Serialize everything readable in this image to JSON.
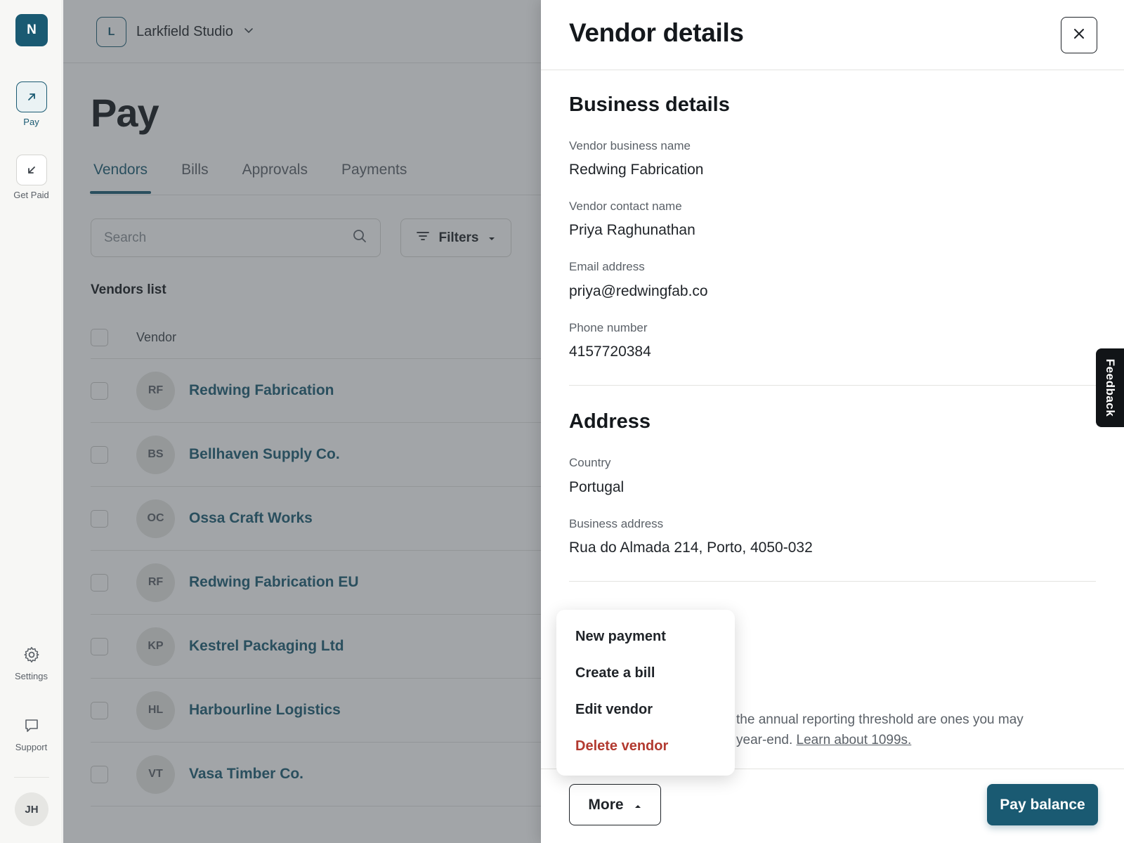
{
  "rail": {
    "org_initial": "N",
    "items": [
      {
        "label": "Pay",
        "icon": "arrow-up-right-icon",
        "active": true
      },
      {
        "label": "Get Paid",
        "icon": "arrow-down-left-icon",
        "active": false
      },
      {
        "label": "Settings",
        "icon": "gear-icon",
        "active": false
      },
      {
        "label": "Support",
        "icon": "chat-bubble-icon",
        "active": false
      }
    ],
    "user_initials": "JH"
  },
  "topbar": {
    "org_initial": "L",
    "org_name": "Larkfield Studio",
    "icon": "chevron-down-icon"
  },
  "page": {
    "title": "Pay",
    "tabs": [
      {
        "label": "Vendors",
        "active": true
      },
      {
        "label": "Bills",
        "active": false
      },
      {
        "label": "Approvals",
        "active": false
      },
      {
        "label": "Payments",
        "active": false
      }
    ],
    "search": {
      "placeholder": "Search",
      "value": ""
    },
    "filters_label": "Filters",
    "list_title": "Vendors list",
    "table": {
      "columns": [
        "Vendor"
      ],
      "rows": [
        {
          "initials": "RF",
          "name": "Redwing Fabrication"
        },
        {
          "initials": "BS",
          "name": "Bellhaven Supply Co."
        },
        {
          "initials": "OC",
          "name": "Ossa Craft Works"
        },
        {
          "initials": "RF",
          "name": "Redwing Fabrication EU"
        },
        {
          "initials": "KP",
          "name": "Kestrel Packaging Ltd"
        },
        {
          "initials": "HL",
          "name": "Harbourline Logistics"
        },
        {
          "initials": "VT",
          "name": "Vasa Timber Co."
        }
      ]
    }
  },
  "drawer": {
    "title": "Vendor details",
    "business": {
      "heading": "Business details",
      "fields": [
        {
          "label": "Vendor business name",
          "value": "Redwing Fabrication"
        },
        {
          "label": "Vendor contact name",
          "value": "Priya Raghunathan"
        },
        {
          "label": "Email address",
          "value": "priya@redwingfab.co"
        },
        {
          "label": "Phone number",
          "value": "4157720384"
        }
      ]
    },
    "address": {
      "heading": "Address",
      "fields": [
        {
          "label": "Country",
          "value": "Portugal"
        },
        {
          "label": "Business address",
          "value": "Rua do Almada 214, Porto, 4050-032"
        }
      ]
    },
    "note_line1": "the annual reporting threshold are ones you may",
    "note_line2_prefix": "year-end. ",
    "note_link": "Learn about 1099s.",
    "more_label": "More",
    "pay_label": "Pay balance",
    "menu": [
      {
        "label": "New payment",
        "danger": false
      },
      {
        "label": "Create a bill",
        "danger": false
      },
      {
        "label": "Edit vendor",
        "danger": false
      },
      {
        "label": "Delete vendor",
        "danger": true
      }
    ]
  },
  "feedback_label": "Feedback",
  "colors": {
    "brand": "#1a5a72",
    "danger": "#b23a30",
    "overlay": "rgba(60,66,74,0.48)"
  }
}
